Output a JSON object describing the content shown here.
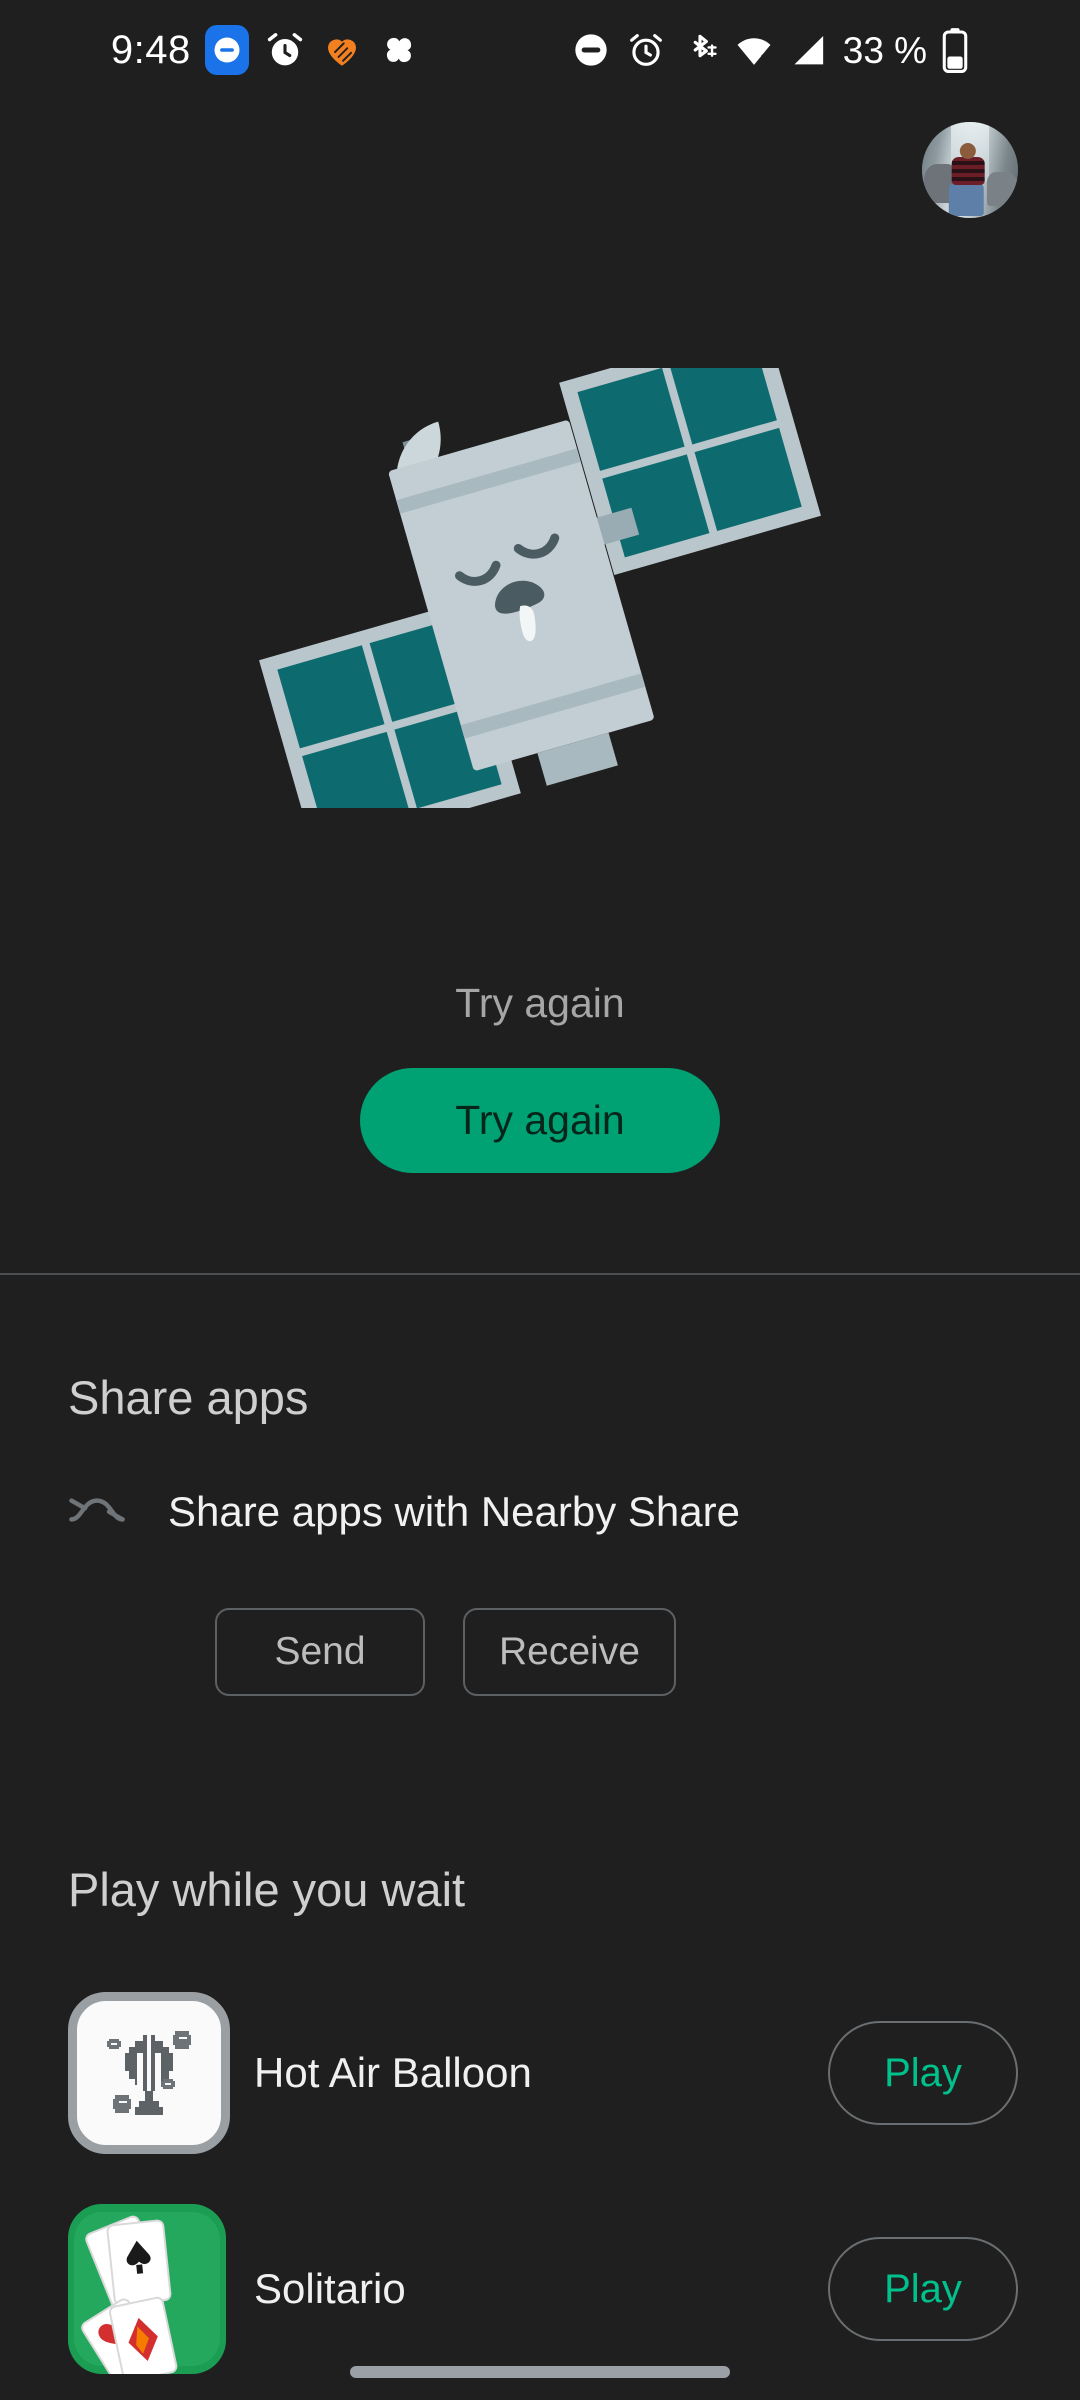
{
  "status_bar": {
    "time": "9:48",
    "left_icons": [
      "dnd-badge-icon",
      "alarm-icon",
      "fitness-heart-icon",
      "pinwheel-icon"
    ],
    "right_icons": [
      "dnd-icon",
      "alarm-icon",
      "bluetooth-icon",
      "wifi-icon",
      "signal-icon"
    ],
    "battery_percent": "33 %",
    "battery_icon": "battery-icon"
  },
  "account": {
    "avatar_name": "account-avatar"
  },
  "hero": {
    "illustration": "sad-satellite-illustration",
    "message": "Try again",
    "button_label": "Try again"
  },
  "share": {
    "title": "Share apps",
    "icon": "nearby-share-icon",
    "row_label": "Share apps with Nearby Share",
    "chips": [
      {
        "label": "Send"
      },
      {
        "label": "Receive"
      }
    ]
  },
  "games": {
    "title": "Play while you wait",
    "items": [
      {
        "name": "Hot Air Balloon",
        "icon": "hot-air-balloon-game-icon",
        "action": "Play"
      },
      {
        "name": "Solitario",
        "icon": "solitaire-game-icon",
        "action": "Play"
      }
    ]
  },
  "colors": {
    "background": "#1f1f1f",
    "accent_green": "#00a173",
    "play_green": "#00c08b",
    "divider": "#4b4f52",
    "satellite_body": "#bfcbd1",
    "solar_panel": "#0d6b6f"
  }
}
